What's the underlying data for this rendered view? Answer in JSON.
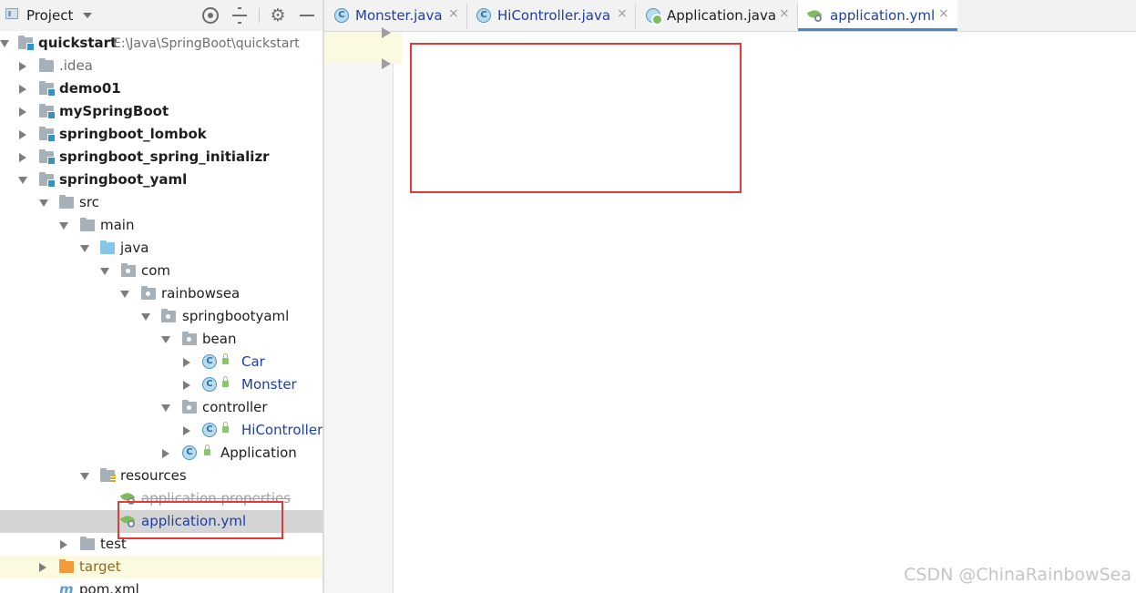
{
  "project_panel": {
    "title": "Project",
    "tree": [
      {
        "label": "quickstart",
        "path": "E:\\Java\\SpringBoot\\quickstart",
        "icon": "module-folder-icon"
      },
      {
        "label": ".idea",
        "icon": "folder-icon"
      },
      {
        "label": "demo01",
        "icon": "module-folder-icon"
      },
      {
        "label": "mySpringBoot",
        "icon": "module-folder-icon"
      },
      {
        "label": "springboot_lombok",
        "icon": "module-folder-icon"
      },
      {
        "label": "springboot_spring_initializr",
        "icon": "module-folder-icon"
      },
      {
        "label": "springboot_yaml",
        "icon": "module-folder-icon"
      },
      {
        "label": "src",
        "icon": "folder-icon"
      },
      {
        "label": "main",
        "icon": "folder-icon"
      },
      {
        "label": "java",
        "icon": "source-folder-icon"
      },
      {
        "label": "com",
        "icon": "package-icon"
      },
      {
        "label": "rainbowsea",
        "icon": "package-icon"
      },
      {
        "label": "springbootyaml",
        "icon": "package-icon"
      },
      {
        "label": "bean",
        "icon": "package-icon"
      },
      {
        "label": "Car",
        "icon": "class-icon"
      },
      {
        "label": "Monster",
        "icon": "class-icon"
      },
      {
        "label": "controller",
        "icon": "package-icon"
      },
      {
        "label": "HiController",
        "icon": "class-icon"
      },
      {
        "label": "Application",
        "icon": "spring-boot-class-icon"
      },
      {
        "label": "resources",
        "icon": "resources-folder-icon"
      },
      {
        "label": "application.properties",
        "icon": "spring-config-icon"
      },
      {
        "label": "application.yml",
        "icon": "spring-config-icon"
      },
      {
        "label": "test",
        "icon": "folder-icon"
      },
      {
        "label": "target",
        "icon": "excluded-folder-icon"
      },
      {
        "label": "pom.xml",
        "icon": "maven-icon"
      }
    ]
  },
  "tabs": [
    {
      "label": "Monster.java",
      "icon": "class-icon"
    },
    {
      "label": "HiController.java",
      "icon": "class-icon"
    },
    {
      "label": "Application.java",
      "icon": "spring-boot-class-icon"
    },
    {
      "label": "application.yml",
      "icon": "spring-config-icon"
    }
  ],
  "toolbar": {
    "close_symbol": "×",
    "gear_symbol": "⚙"
  },
  "watermark": "CSDN @ChinaRainbowSea",
  "colors": {
    "accent": "#4a87c6",
    "highlight_box": "#e53935",
    "selected_row": "#d4d4d4",
    "link_blue": "#1e3fa6"
  }
}
